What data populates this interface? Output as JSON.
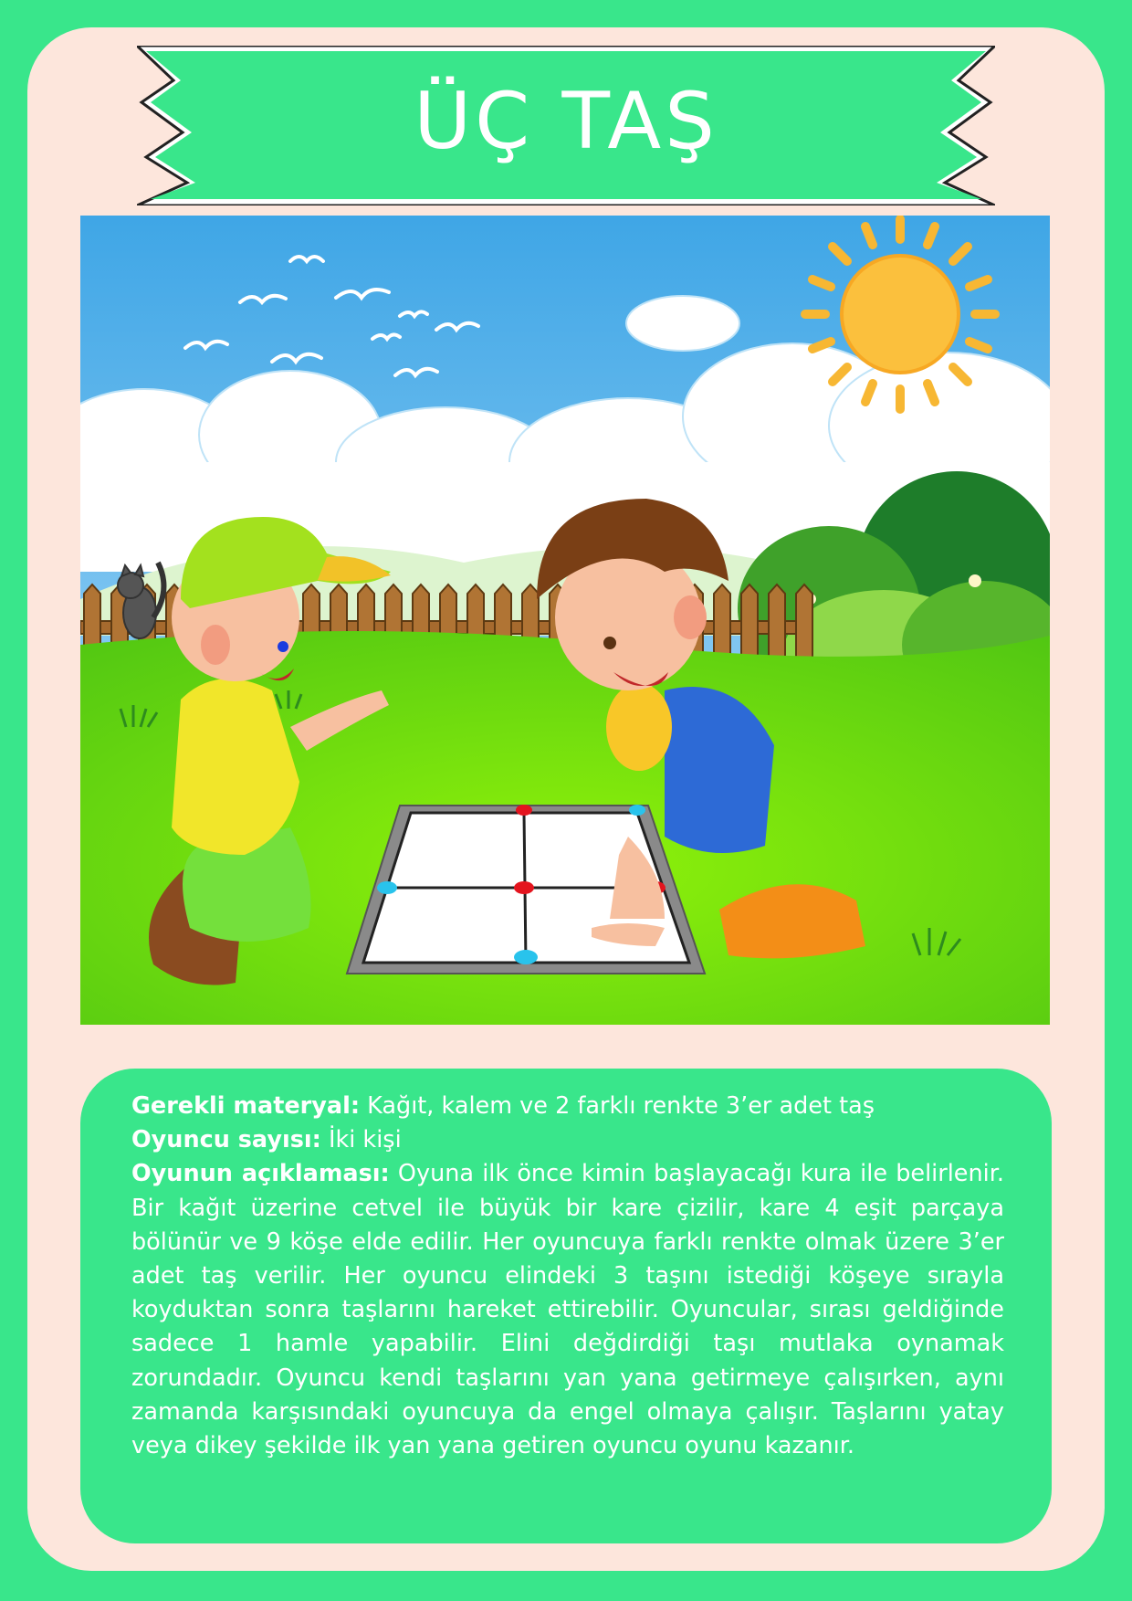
{
  "title": "ÜÇ TAŞ",
  "info": {
    "materials_label": "Gerekli materyal:",
    "materials_value": " Kağıt, kalem ve 2 farklı renkte 3’er adet taş",
    "players_label": "Oyuncu sayısı:",
    "players_value": " İki kişi",
    "description_label": "Oyunun açıklaması:",
    "description_value": " Oyuna ilk önce kimin başlayacağı kura ile belirlenir. Bir kağıt üzerine cetvel ile büyük bir kare çizilir, kare 4 eşit parçaya bölünür ve 9 köşe elde edilir. Her oyuncuya farklı renkte olmak üzere 3’er adet taş verilir. Her oyuncu elindeki 3 taşını istediği köşeye sırayla koyduktan sonra taşlarını hareket ettirebilir. Oyuncular, sırası geldiğinde sadece 1 hamle yapabilir. Elini değdirdiği taşı mutlaka oynamak zorundadır. Oyuncu kendi taşlarını yan yana getirmeye çalışırken, aynı zamanda karşısındaki oyuncuya da engel olmaya çalışır. Taşlarını yatay veya dikey şekilde ilk yan yana getiren oyuncu oyunu kazanır."
  },
  "colors": {
    "background": "#39e68b",
    "card": "#fde6dc",
    "red_stone": "#e4141e",
    "blue_stone": "#29c3ec"
  }
}
